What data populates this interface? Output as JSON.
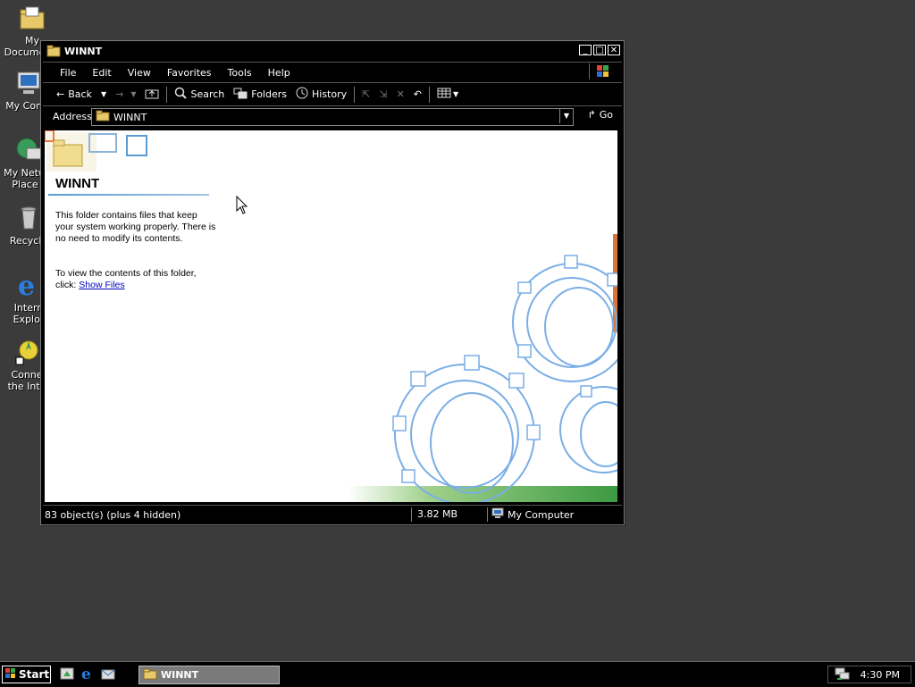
{
  "desktop": {
    "icons": [
      {
        "label": "My Documents",
        "icon": "folder-documents-icon"
      },
      {
        "label": "My Comp",
        "icon": "computer-icon"
      },
      {
        "label": "My Netw Place",
        "icon": "network-places-icon"
      },
      {
        "label": "Recycle",
        "icon": "recycle-bin-icon"
      },
      {
        "label": "Intern Explor",
        "icon": "internet-explorer-icon"
      },
      {
        "label": "Conne the Inte",
        "icon": "connect-internet-icon"
      }
    ]
  },
  "window": {
    "title": "WINNT",
    "menu": [
      "File",
      "Edit",
      "View",
      "Favorites",
      "Tools",
      "Help"
    ],
    "toolbar": {
      "back": "Back",
      "search": "Search",
      "folders": "Folders",
      "history": "History"
    },
    "address": {
      "label": "Address",
      "value": "WINNT",
      "go": "Go"
    },
    "content": {
      "folder_name": "WINNT",
      "description": "This folder contains files that keep your system working properly. There is no need to modify its contents.",
      "view_prompt": "To view the contents of this folder, click:",
      "show_files": "Show Files"
    },
    "status": {
      "objects": "83 object(s) (plus 4 hidden)",
      "size": "3.82 MB",
      "zone": "My Computer"
    }
  },
  "taskbar": {
    "start": "Start",
    "task": "WINNT",
    "clock": "4:30 PM"
  },
  "colors": {
    "desktop": "#3b3b3b",
    "window": "#000000",
    "link": "#0000c0",
    "gear": "#7aaee6"
  }
}
